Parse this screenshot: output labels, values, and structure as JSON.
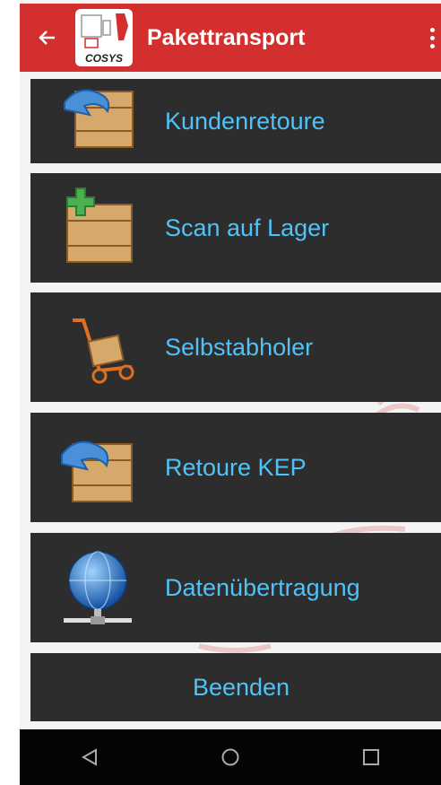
{
  "appbar": {
    "title": "Pakettransport",
    "back_icon": "arrow-left-icon",
    "logo_text": "COSYS"
  },
  "menu": [
    {
      "label": "Kundenretoure",
      "icon": "box-return-icon"
    },
    {
      "label": "Scan auf Lager",
      "icon": "box-add-icon"
    },
    {
      "label": "Selbstabholer",
      "icon": "hand-truck-icon"
    },
    {
      "label": "Retoure KEP",
      "icon": "box-return-icon"
    },
    {
      "label": "Datenübertragung",
      "icon": "globe-network-icon"
    },
    {
      "label": "Beenden"
    }
  ],
  "navbar": {
    "back": "triangle-back-icon",
    "home": "circle-home-icon",
    "recent": "square-recent-icon"
  },
  "colors": {
    "appbar": "#d32f2f",
    "tile": "#2d2d2d",
    "label": "#4fc3f7"
  }
}
